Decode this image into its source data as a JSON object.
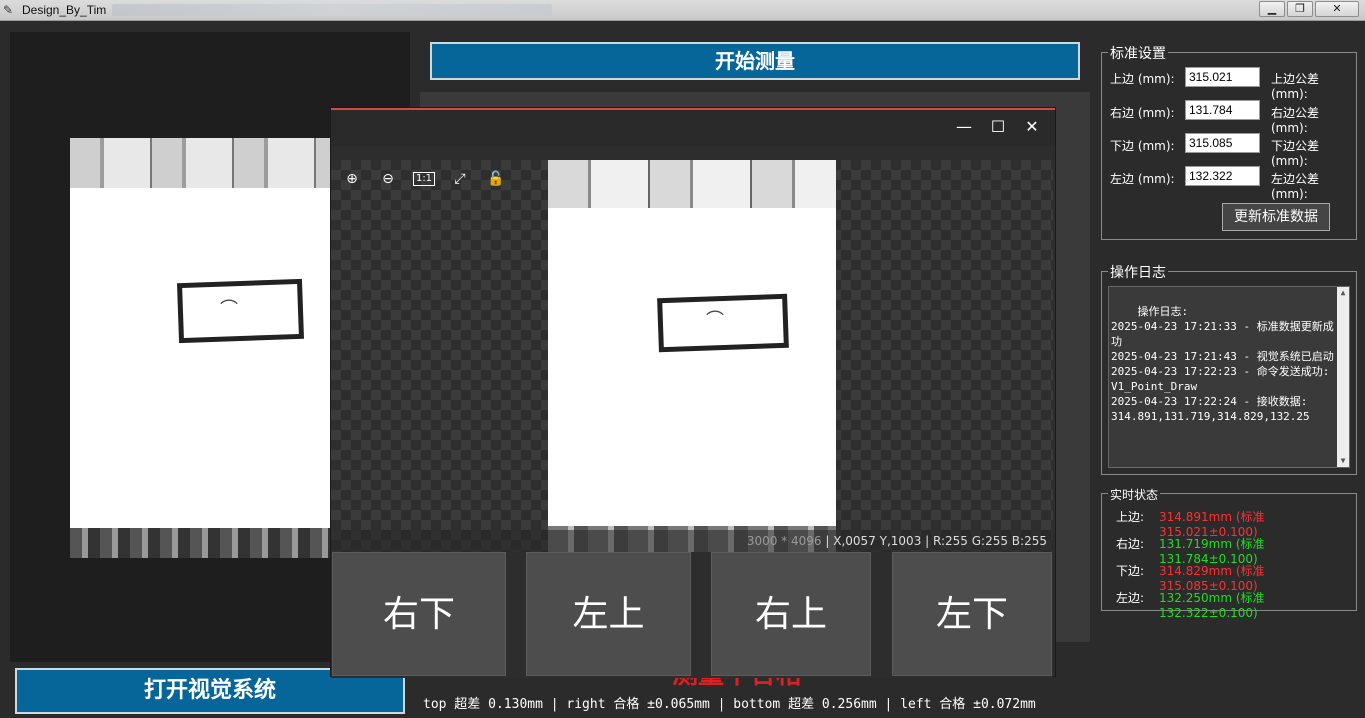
{
  "window": {
    "title": "Design_By_Tim",
    "buttons": {
      "minimize": "▁",
      "maximize": "❐",
      "close": "✕"
    }
  },
  "buttons": {
    "open_vision": "打开视觉系统",
    "start_measure": "开始测量",
    "update_standard": "更新标准数据"
  },
  "viewer": {
    "controls": {
      "minimize": "—",
      "maximize": "☐",
      "close": "✕"
    },
    "tools": {
      "zoom_in": "⊕",
      "zoom_out": "⊖",
      "actual_size": "1:1",
      "fit": "⤢",
      "lock": "🔓"
    },
    "status": {
      "resolution": "3000 * 4096",
      "coords": "X,0057 Y,1003",
      "rgb": "R:255 G:255 B:255"
    },
    "directions": [
      "右下",
      "左上",
      "右上",
      "左下"
    ]
  },
  "result_text": "测量不合格",
  "summary": "top 超差 0.130mm | right 合格 ±0.065mm | bottom 超差 0.256mm | left 合格 ±0.072mm",
  "standard": {
    "title": "标准设置",
    "rows": [
      {
        "label": "上边 (mm):",
        "value": "315.021",
        "tol_label": "上边公差 (mm):"
      },
      {
        "label": "右边 (mm):",
        "value": "131.784",
        "tol_label": "右边公差 (mm):"
      },
      {
        "label": "下边 (mm):",
        "value": "315.085",
        "tol_label": "下边公差 (mm):"
      },
      {
        "label": "左边 (mm):",
        "value": "132.322",
        "tol_label": "左边公差 (mm):"
      }
    ]
  },
  "log": {
    "title": "操作日志",
    "text": "操作日志:\n2025-04-23 17:21:33 - 标准数据更新成功\n2025-04-23 17:21:43 - 视觉系统已启动\n2025-04-23 17:22:23 - 命令发送成功: V1_Point_Draw\n2025-04-23 17:22:24 - 接收数据: 314.891,131.719,314.829,132.25"
  },
  "realtime": {
    "title": "实时状态",
    "rows": [
      {
        "label": "上边:",
        "value": "314.891mm (标准315.021±0.100)",
        "color": "#ff3030"
      },
      {
        "label": "右边:",
        "value": "131.719mm (标准131.784±0.100)",
        "color": "#22dd22"
      },
      {
        "label": "下边:",
        "value": "314.829mm (标准315.085±0.100)",
        "color": "#ff3030"
      },
      {
        "label": "左边:",
        "value": "132.250mm (标准132.322±0.100)",
        "color": "#22dd22"
      }
    ]
  }
}
